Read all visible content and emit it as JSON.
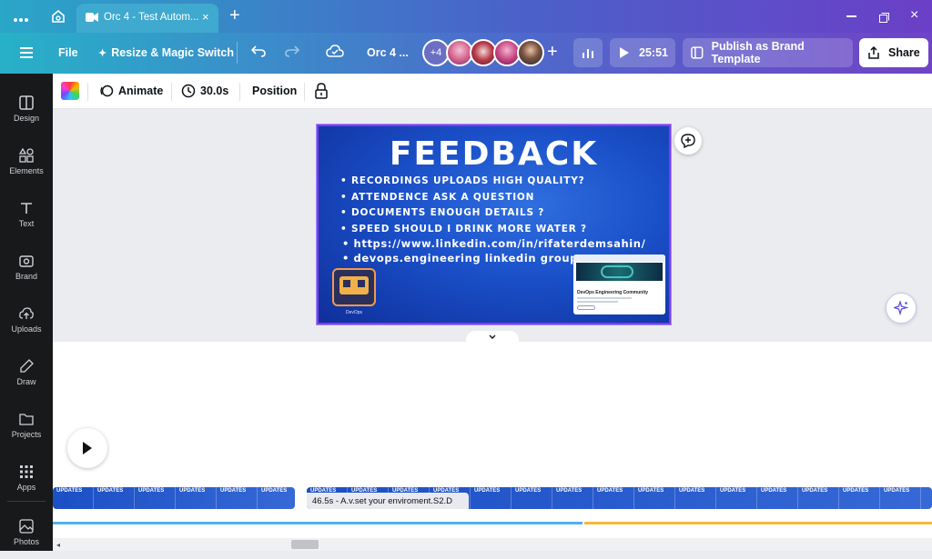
{
  "tabbar": {
    "tab_title": "Orc 4 - Test Autom..."
  },
  "toolbar": {
    "file_label": "File",
    "resize_label": "Resize & Magic Switch",
    "doc_title": "Orc 4 ...",
    "collab_count": "+4",
    "present_time": "25:51",
    "publish_label": "Publish as Brand Template",
    "share_label": "Share"
  },
  "sidebar": {
    "items": [
      {
        "label": "Design",
        "icon": "design-icon"
      },
      {
        "label": "Elements",
        "icon": "elements-icon"
      },
      {
        "label": "Text",
        "icon": "text-icon"
      },
      {
        "label": "Brand",
        "icon": "brand-icon"
      },
      {
        "label": "Uploads",
        "icon": "uploads-icon"
      },
      {
        "label": "Draw",
        "icon": "draw-icon"
      },
      {
        "label": "Projects",
        "icon": "projects-icon"
      },
      {
        "label": "Apps",
        "icon": "apps-icon"
      },
      {
        "label": "Photos",
        "icon": "photos-icon"
      }
    ]
  },
  "context_bar": {
    "animate_label": "Animate",
    "duration_label": "30.0s",
    "position_label": "Position"
  },
  "slide": {
    "title": "FEEDBACK",
    "bullets": [
      "• RECORDINGS UPLOADS HIGH QUALITY?",
      "• ATTENDENCE ASK A QUESTION",
      "• DOCUMENTS ENOUGH DETAILS ?",
      "• SPEED SHOULD I DRINK MORE WATER ?",
      "• https://www.linkedin.com/in/rifaterdemsahin/",
      "• devops.engineering linkedin group"
    ],
    "logo_caption": "DevOps",
    "card_title": "DevOps Engineering Community"
  },
  "timeline": {
    "frame_label": "UPDATES",
    "clip_tooltip": "46.5s - A.v.set your enviroment.S2.D"
  },
  "colors": {
    "accent": "#7d3cf0",
    "progress_blue": "#4db3f0",
    "progress_yellow": "#f5b93a"
  }
}
